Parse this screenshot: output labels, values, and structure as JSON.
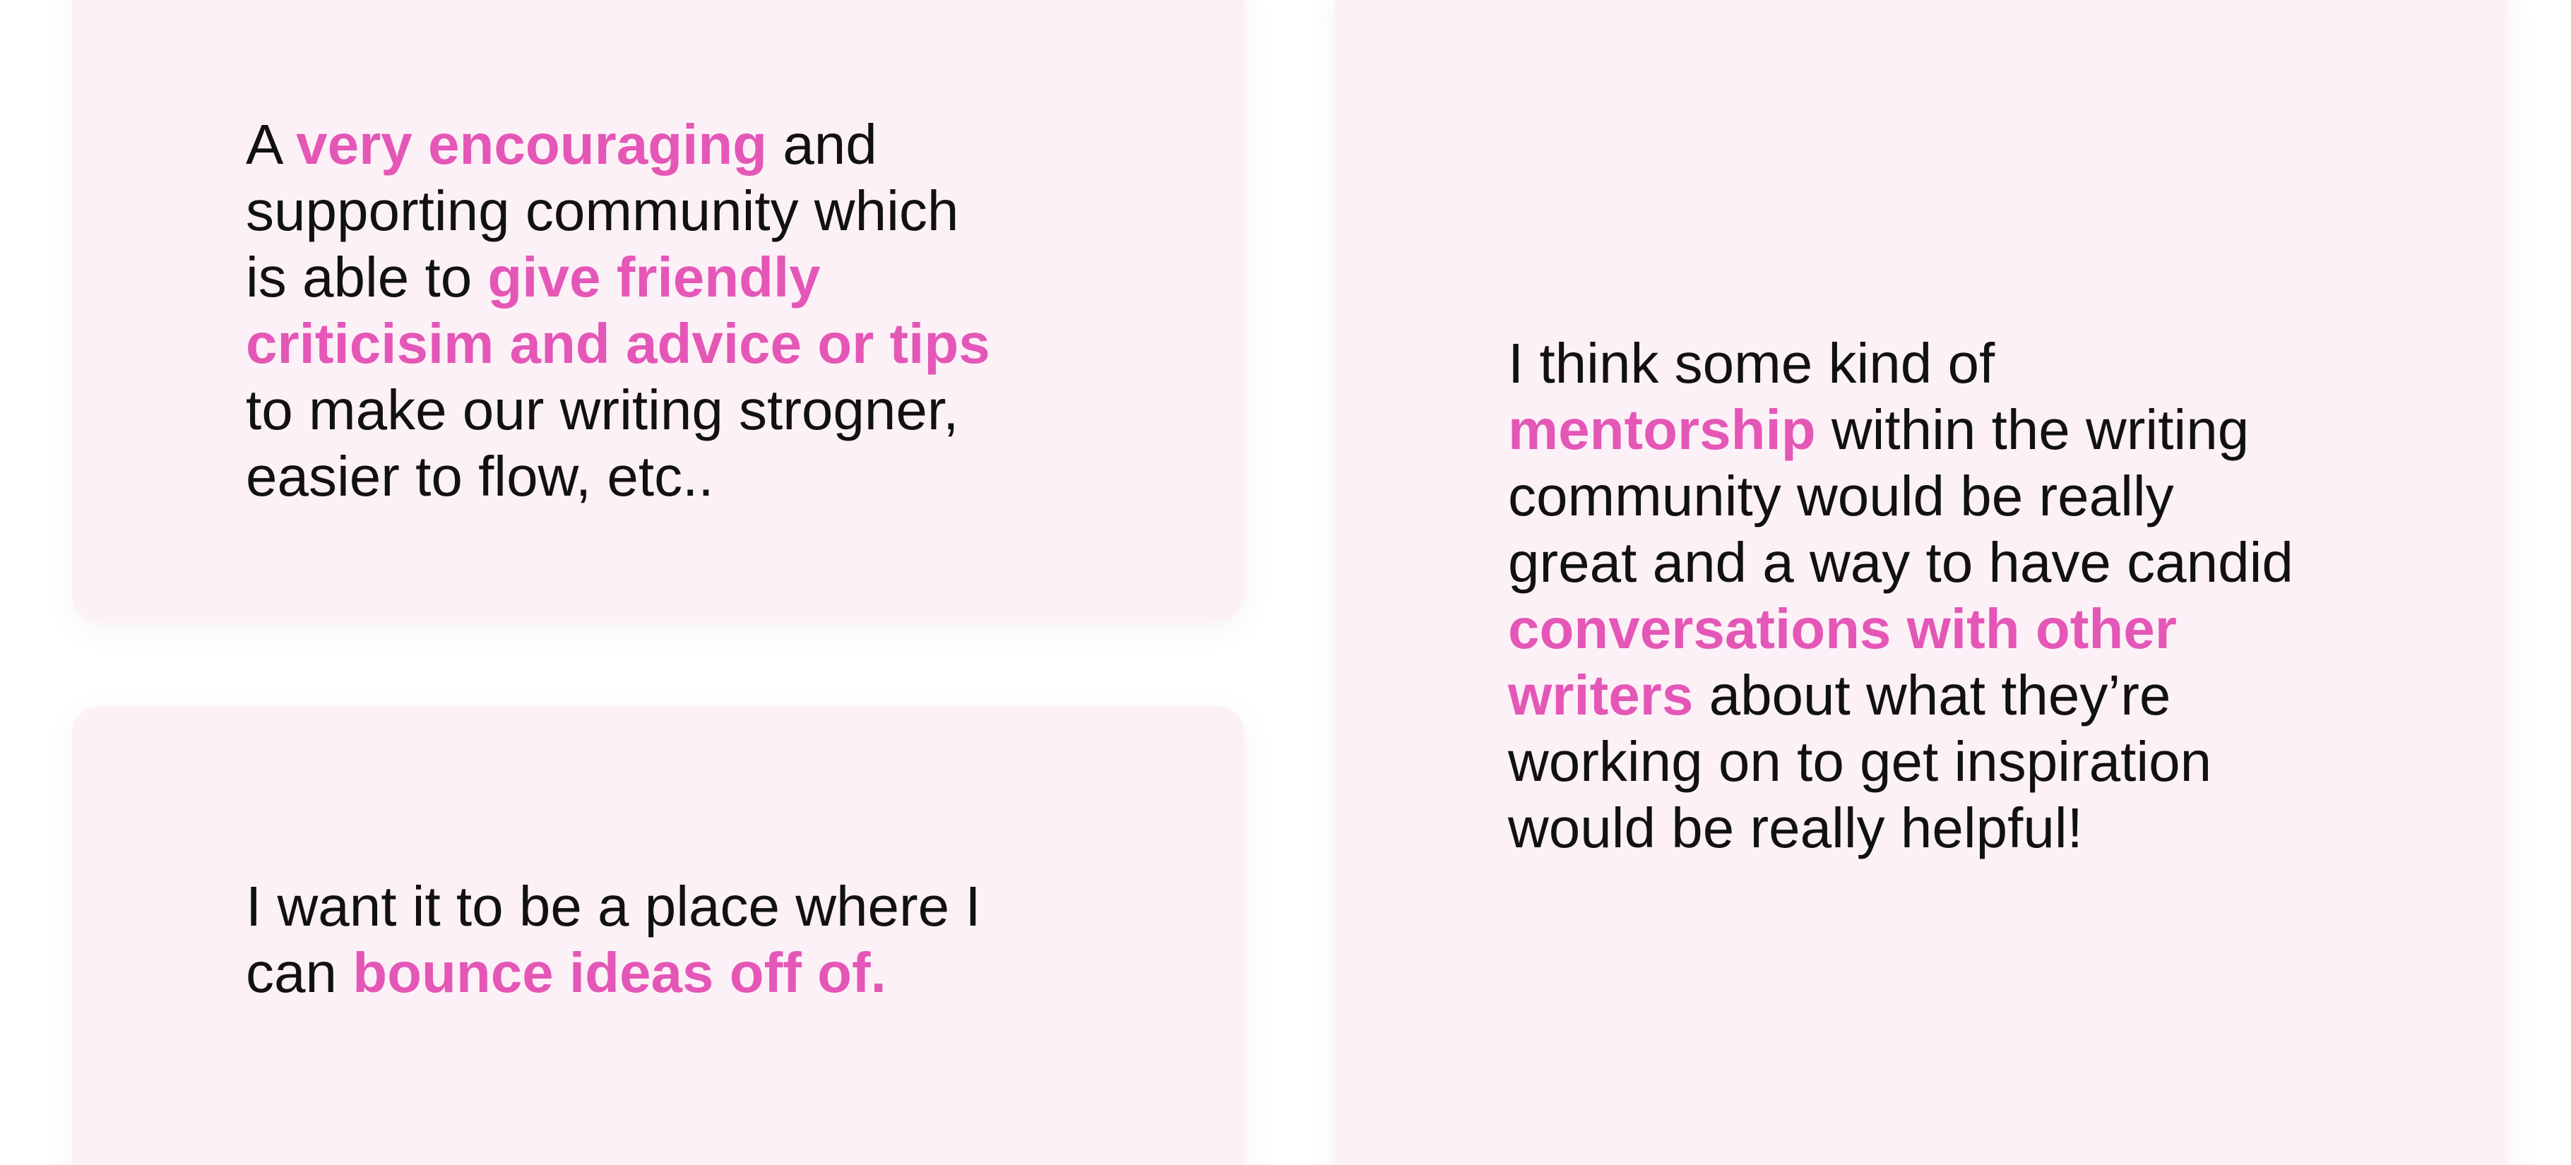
{
  "colors": {
    "page_background": "#ffffff",
    "card_background": "#fdf1f8",
    "text": "#111111",
    "highlight": "#e457b7"
  },
  "cards": [
    {
      "lines": [
        [
          {
            "t": "A ",
            "hl": false
          },
          {
            "t": "very encouraging",
            "hl": true
          },
          {
            "t": " and",
            "hl": false
          }
        ],
        [
          {
            "t": "supporting community which",
            "hl": false
          }
        ],
        [
          {
            "t": "is able to ",
            "hl": false
          },
          {
            "t": "give friendly",
            "hl": true
          }
        ],
        [
          {
            "t": "criticisim and advice or tips",
            "hl": true
          }
        ],
        [
          {
            "t": "to make our writing strogner,",
            "hl": false
          }
        ],
        [
          {
            "t": "easier to flow, etc..",
            "hl": false
          }
        ]
      ]
    },
    {
      "lines": [
        [
          {
            "t": "I want it to be a place where I",
            "hl": false
          }
        ],
        [
          {
            "t": "can ",
            "hl": false
          },
          {
            "t": "bounce ideas off of.",
            "hl": true
          }
        ]
      ]
    },
    {
      "lines": [
        [
          {
            "t": "I think some kind of",
            "hl": false
          }
        ],
        [
          {
            "t": "mentorship",
            "hl": true
          },
          {
            "t": " within the writing",
            "hl": false
          }
        ],
        [
          {
            "t": "community would be really",
            "hl": false
          }
        ],
        [
          {
            "t": "great and a way to have candid",
            "hl": false
          }
        ],
        [
          {
            "t": "conversations with other",
            "hl": true
          }
        ],
        [
          {
            "t": "writers",
            "hl": true
          },
          {
            "t": " about what they’re",
            "hl": false
          }
        ],
        [
          {
            "t": "working on to get inspiration",
            "hl": false
          }
        ],
        [
          {
            "t": "would be really helpful!",
            "hl": false
          }
        ]
      ]
    }
  ]
}
